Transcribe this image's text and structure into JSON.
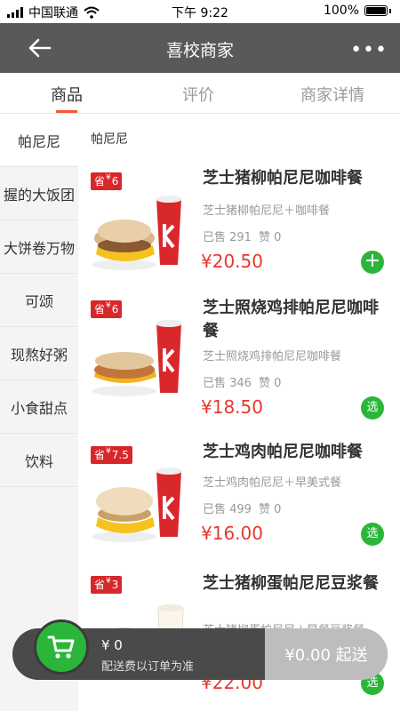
{
  "status": {
    "carrier": "中国联通",
    "time": "下午 9:22",
    "battery": "100%"
  },
  "navbar": {
    "title": "喜校商家",
    "more": "•••"
  },
  "tabs": [
    {
      "label": "商品",
      "active": true
    },
    {
      "label": "评价",
      "active": false
    },
    {
      "label": "商家详情",
      "active": false
    }
  ],
  "sidebar": [
    {
      "label": "帕尼尼",
      "active": true
    },
    {
      "label": "握的大饭团"
    },
    {
      "label": "大饼卷万物"
    },
    {
      "label": "可颂"
    },
    {
      "label": "现熬好粥"
    },
    {
      "label": "小食甜点"
    },
    {
      "label": "饮料"
    }
  ],
  "category_title": "帕尼尼",
  "items": [
    {
      "badge_prefix": "省",
      "badge_currency": "¥",
      "badge_value": "6",
      "name": "芝士猪柳帕尼尼咖啡餐",
      "desc": "芝士猪柳帕尼尼＋咖啡餐",
      "sold": "已售 291",
      "likes": "赞 0",
      "price": "¥20.50",
      "action": "+"
    },
    {
      "badge_prefix": "省",
      "badge_currency": "¥",
      "badge_value": "6",
      "name": "芝士照烧鸡排帕尼尼咖啡餐",
      "desc": "芝士照烧鸡排帕尼尼咖啡餐",
      "sold": "已售 346",
      "likes": "赞 0",
      "price": "¥18.50",
      "action": "选"
    },
    {
      "badge_prefix": "省",
      "badge_currency": "¥",
      "badge_value": "7.5",
      "name": "芝士鸡肉帕尼尼咖啡餐",
      "desc": "芝士鸡肉帕尼尼＋早美式餐",
      "sold": "已售 499",
      "likes": "赞 0",
      "price": "¥16.00",
      "action": "选"
    },
    {
      "badge_prefix": "省",
      "badge_currency": "¥",
      "badge_value": "3",
      "name": "芝士猪柳蛋帕尼尼豆浆餐",
      "desc": "芝士猪柳蛋帕尼尼＋早餐豆浆餐",
      "sold": "",
      "likes": "",
      "price": "¥22.00",
      "action": "选"
    }
  ],
  "cart": {
    "amount": "¥ 0",
    "note": "配送费以订单为准",
    "submit": "¥0.00 起送"
  },
  "colors": {
    "accent": "#f25b2a",
    "price": "#e8382d",
    "green": "#2bb53a",
    "navbar": "#595959"
  }
}
